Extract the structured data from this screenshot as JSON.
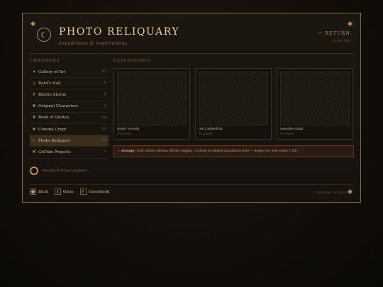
{
  "header": {
    "emblem_glyph": "☾",
    "title": "PHOTO RELIQUARY",
    "subtitle": "expeditions & explorations",
    "return_label": "↩ RETURN",
    "return_hint": "to the hub"
  },
  "sections": {
    "chambers_label": "CHAMBERS",
    "expeditions_label": "EXPEDITIONS"
  },
  "chambers": [
    {
      "icon": "✦",
      "label": "Gallery of Art",
      "count": "42",
      "active": false
    },
    {
      "icon": "♫",
      "label": "Bard's Hall",
      "count": "6",
      "active": false
    },
    {
      "icon": "♆",
      "label": "Blorbo Shrine",
      "count": "6",
      "active": false
    },
    {
      "icon": "✾",
      "label": "Original Characters",
      "count": "5",
      "active": false
    },
    {
      "icon": "❦",
      "label": "Book of Quotes",
      "count": "88",
      "active": false
    },
    {
      "icon": "❖",
      "label": "Cinema Crypt",
      "count": "31",
      "active": false
    },
    {
      "icon": "☾",
      "label": "Photo Reliquary",
      "count": "120",
      "active": true
    },
    {
      "icon": "⚒",
      "label": "GitHub Projects",
      "count": "↗",
      "active": false
    }
  ],
  "expeditions": [
    {
      "name": "misty woods",
      "count": "24 plates"
    },
    {
      "name": "old cathedral",
      "count": "18 plates"
    },
    {
      "name": "seaside dusk",
      "count": "31 plates"
    }
  ],
  "storage": {
    "icon": "⚠",
    "label": "storage:",
    "text": "host full-res albums off-site (imgbb / carbon) & embed thumbnails here — keeps you well under 1 GB."
  },
  "ring": {
    "text": "Woodland Ring equipped"
  },
  "keys": [
    {
      "key": "Q",
      "label": "Back"
    },
    {
      "key": "E",
      "label": "Open"
    },
    {
      "key": "F",
      "label": "Guestbook"
    }
  ],
  "footer": {
    "chamber_position": "◌ chamber vii of vii ◌"
  }
}
